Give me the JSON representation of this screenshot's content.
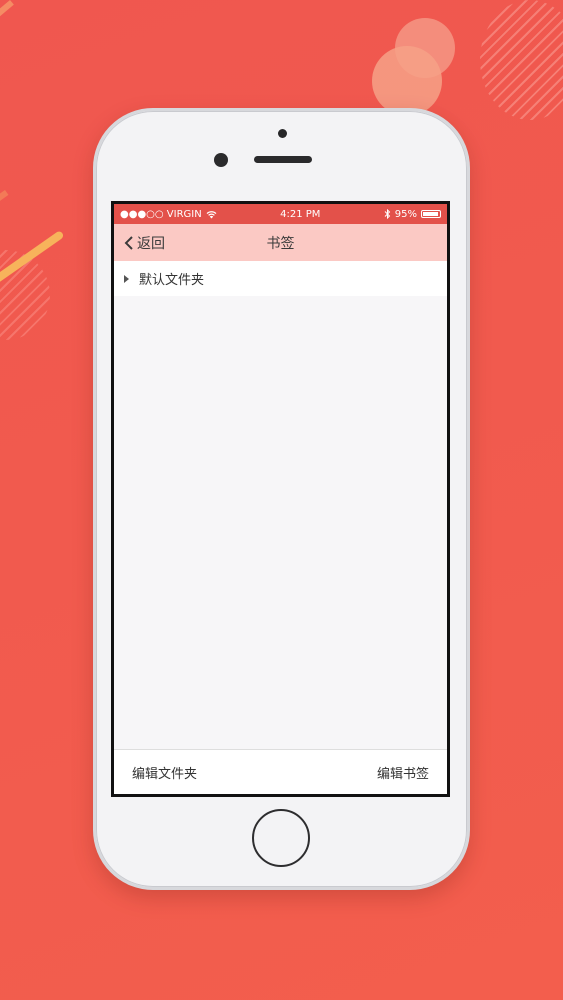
{
  "status_bar": {
    "carrier": "●●●○○ VIRGIN",
    "wifi_icon": "wifi-icon",
    "time": "4:21 PM",
    "bluetooth_icon": "bluetooth-icon",
    "battery_percent": "95%"
  },
  "nav": {
    "back_label": "返回",
    "title": "书签"
  },
  "folders": [
    {
      "label": "默认文件夹"
    }
  ],
  "toolbar": {
    "edit_folder_label": "编辑文件夹",
    "edit_bookmark_label": "编辑书签"
  },
  "colors": {
    "background": "#f15a4e",
    "status_bar": "#e3514a",
    "nav_bar": "#fbc9c4"
  }
}
